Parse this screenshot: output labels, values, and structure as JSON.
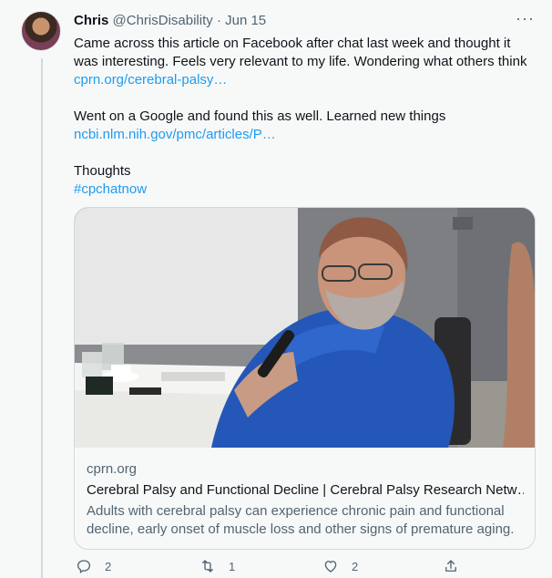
{
  "tweet": {
    "author_name": "Chris",
    "author_handle": "@ChrisDisability",
    "separator": "·",
    "date": "Jun 15",
    "more_label": "···",
    "text_line_1": "Came across this article on Facebook after chat last week and thought it",
    "text_line_2": "was interesting. Feels very relevant to my life. Wondering what others think",
    "link_1": "cprn.org/cerebral-palsy…",
    "text_line_3": "Went on a Google and found this as well. Learned new things",
    "link_2": "ncbi.nlm.nih.gov/pmc/articles/P…",
    "text_line_4": "Thoughts",
    "hashtag": "#cpchatnow"
  },
  "card": {
    "domain": "cprn.org",
    "title": "Cerebral Palsy and Functional Decline | Cerebral Palsy Research Netw…",
    "description_line_1": "Adults with cerebral palsy can experience chronic pain and functional",
    "description_line_2": "decline, early onset of muscle loss and other signs of premature aging."
  },
  "actions": {
    "reply_count": "2",
    "retweet_count": "1",
    "like_count": "2"
  },
  "icons": [
    "avatar",
    "more-icon",
    "reply-icon",
    "retweet-icon",
    "like-icon",
    "share-icon"
  ],
  "colors": {
    "link": "#1d9bf0",
    "secondary_text": "#536471",
    "background": "#f7f9f9"
  }
}
